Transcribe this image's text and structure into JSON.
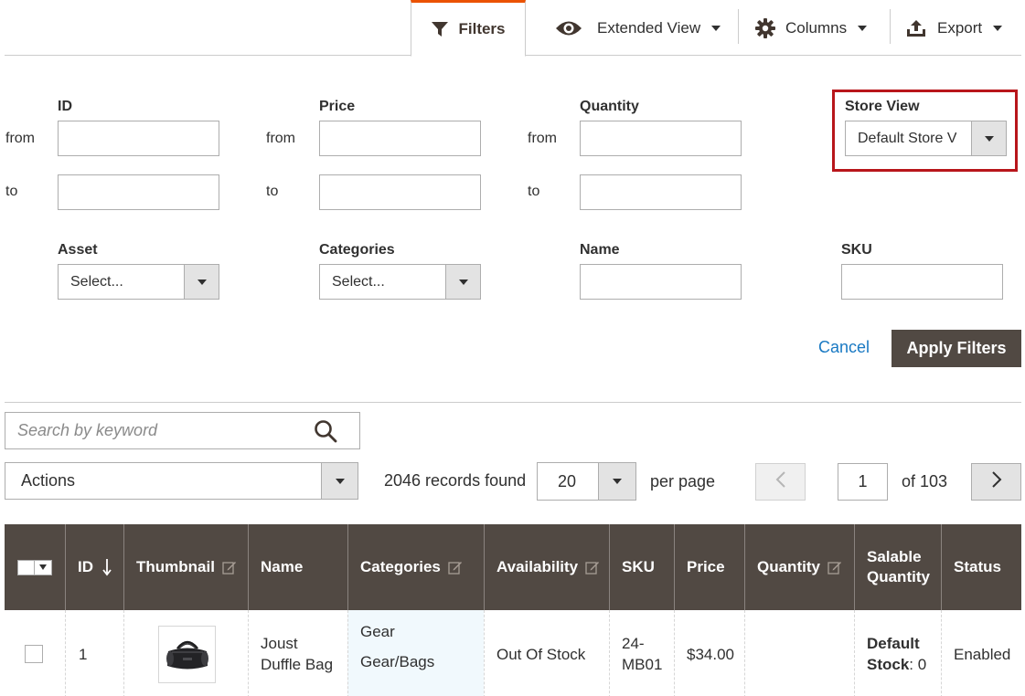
{
  "toolbar": {
    "filters_label": "Filters",
    "view_label": "Extended View",
    "columns_label": "Columns",
    "export_label": "Export"
  },
  "filters": {
    "id_label": "ID",
    "price_label": "Price",
    "quantity_label": "Quantity",
    "store_view_label": "Store View",
    "store_view_value": "Default Store View",
    "from_label": "from",
    "to_label": "to",
    "asset_label": "Asset",
    "asset_value": "Select...",
    "categories_label": "Categories",
    "categories_value": "Select...",
    "name_label": "Name",
    "sku_label": "SKU",
    "cancel_label": "Cancel",
    "apply_label": "Apply Filters"
  },
  "search": {
    "placeholder": "Search by keyword"
  },
  "actions": {
    "label": "Actions"
  },
  "paging": {
    "records_found": "2046 records found",
    "per_page_value": "20",
    "per_page_label": "per page",
    "current_page": "1",
    "of_pages": "of 103"
  },
  "grid": {
    "columns": {
      "id": "ID",
      "thumbnail": "Thumbnail",
      "name": "Name",
      "categories": "Categories",
      "availability": "Availability",
      "sku": "SKU",
      "price": "Price",
      "quantity": "Quantity",
      "salable_quantity_line1": "Salable",
      "salable_quantity_line2": "Quantity",
      "status": "Status"
    },
    "rows": [
      {
        "id": "1",
        "name_line1": "Joust",
        "name_line2": "Duffle Bag",
        "category_1": "Gear",
        "category_2": "Gear/Bags",
        "availability": "Out Of Stock",
        "sku_line1": "24-",
        "sku_line2": "MB01",
        "price": "$34.00",
        "quantity": "",
        "salable_source_line1": "Default",
        "salable_source_line2": "Stock",
        "salable_value": ": 0",
        "status": "Enabled"
      }
    ]
  },
  "colors": {
    "header_bg": "#514943",
    "accent_tab": "#eb5202",
    "link": "#1979c3",
    "highlight_frame": "#b8161b",
    "category_cell_bg": "#f1f9fd"
  },
  "icons": [
    "filter-icon",
    "eye-icon",
    "gear-icon",
    "export-icon",
    "search-icon",
    "edit-icon",
    "sort-down-icon",
    "chevron-left-icon",
    "chevron-right-icon"
  ]
}
